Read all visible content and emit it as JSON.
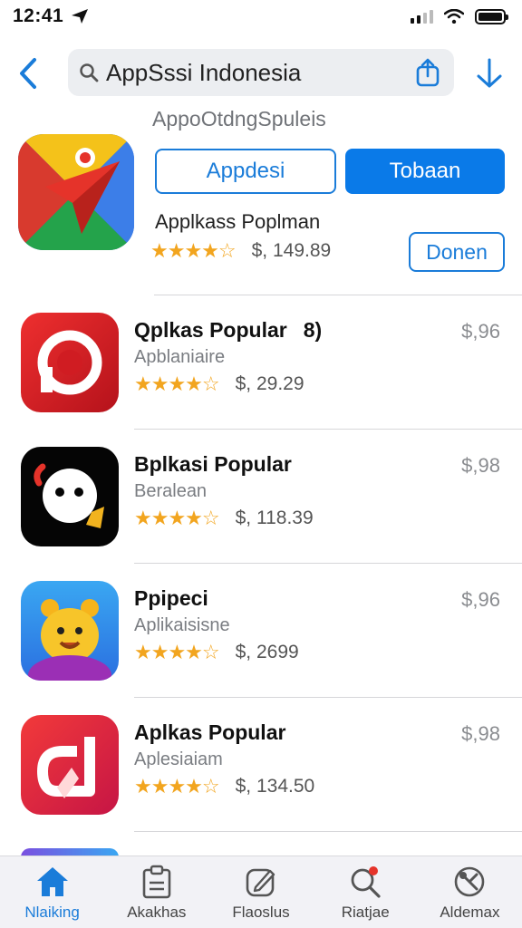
{
  "status_bar": {
    "time": "12:41"
  },
  "search": {
    "query": "AppSssi Indonesia"
  },
  "subtitle": "AppoOtdngSpuleis",
  "featured": {
    "button_primary": "Appdesi",
    "button_secondary": "Tobaan",
    "name": "Applkass Poplman",
    "rating_stars": "★★★★☆",
    "price": "$, 149.89",
    "open_label": "Donen"
  },
  "apps": [
    {
      "name": "Qplkas Popular",
      "extra": "8)",
      "category": "Apblaniaire",
      "stars": "★★★★☆",
      "count": "$, 29.29",
      "price": "$,96",
      "icon": "red-target-icon"
    },
    {
      "name": "Bplkasi Popular",
      "category": "Beralean",
      "stars": "★★★★☆",
      "count": "$, 118.39",
      "price": "$,98",
      "icon": "black-face-icon"
    },
    {
      "name": "Ppipeci",
      "category": "Aplikaisisne",
      "stars": "★★★★☆",
      "count": "$, 2699",
      "price": "$,96",
      "icon": "yellow-bear-icon"
    },
    {
      "name": "Aplkas Popular",
      "category": "Aplesiaiam",
      "stars": "★★★★☆",
      "count": "$, 134.50",
      "price": "$,98",
      "icon": "red-d-icon"
    }
  ],
  "tabs": [
    {
      "label": "Nlaiking",
      "icon": "home-icon",
      "active": true
    },
    {
      "label": "Akakhas",
      "icon": "clipboard-icon"
    },
    {
      "label": "Flaoslus",
      "icon": "edit-icon"
    },
    {
      "label": "Riatjae",
      "icon": "search-icon"
    },
    {
      "label": "Aldemax",
      "icon": "tools-icon"
    }
  ],
  "colors": {
    "accent": "#0a7ae8",
    "star": "#f2a51f",
    "tab_bg": "#f2f2f6"
  }
}
